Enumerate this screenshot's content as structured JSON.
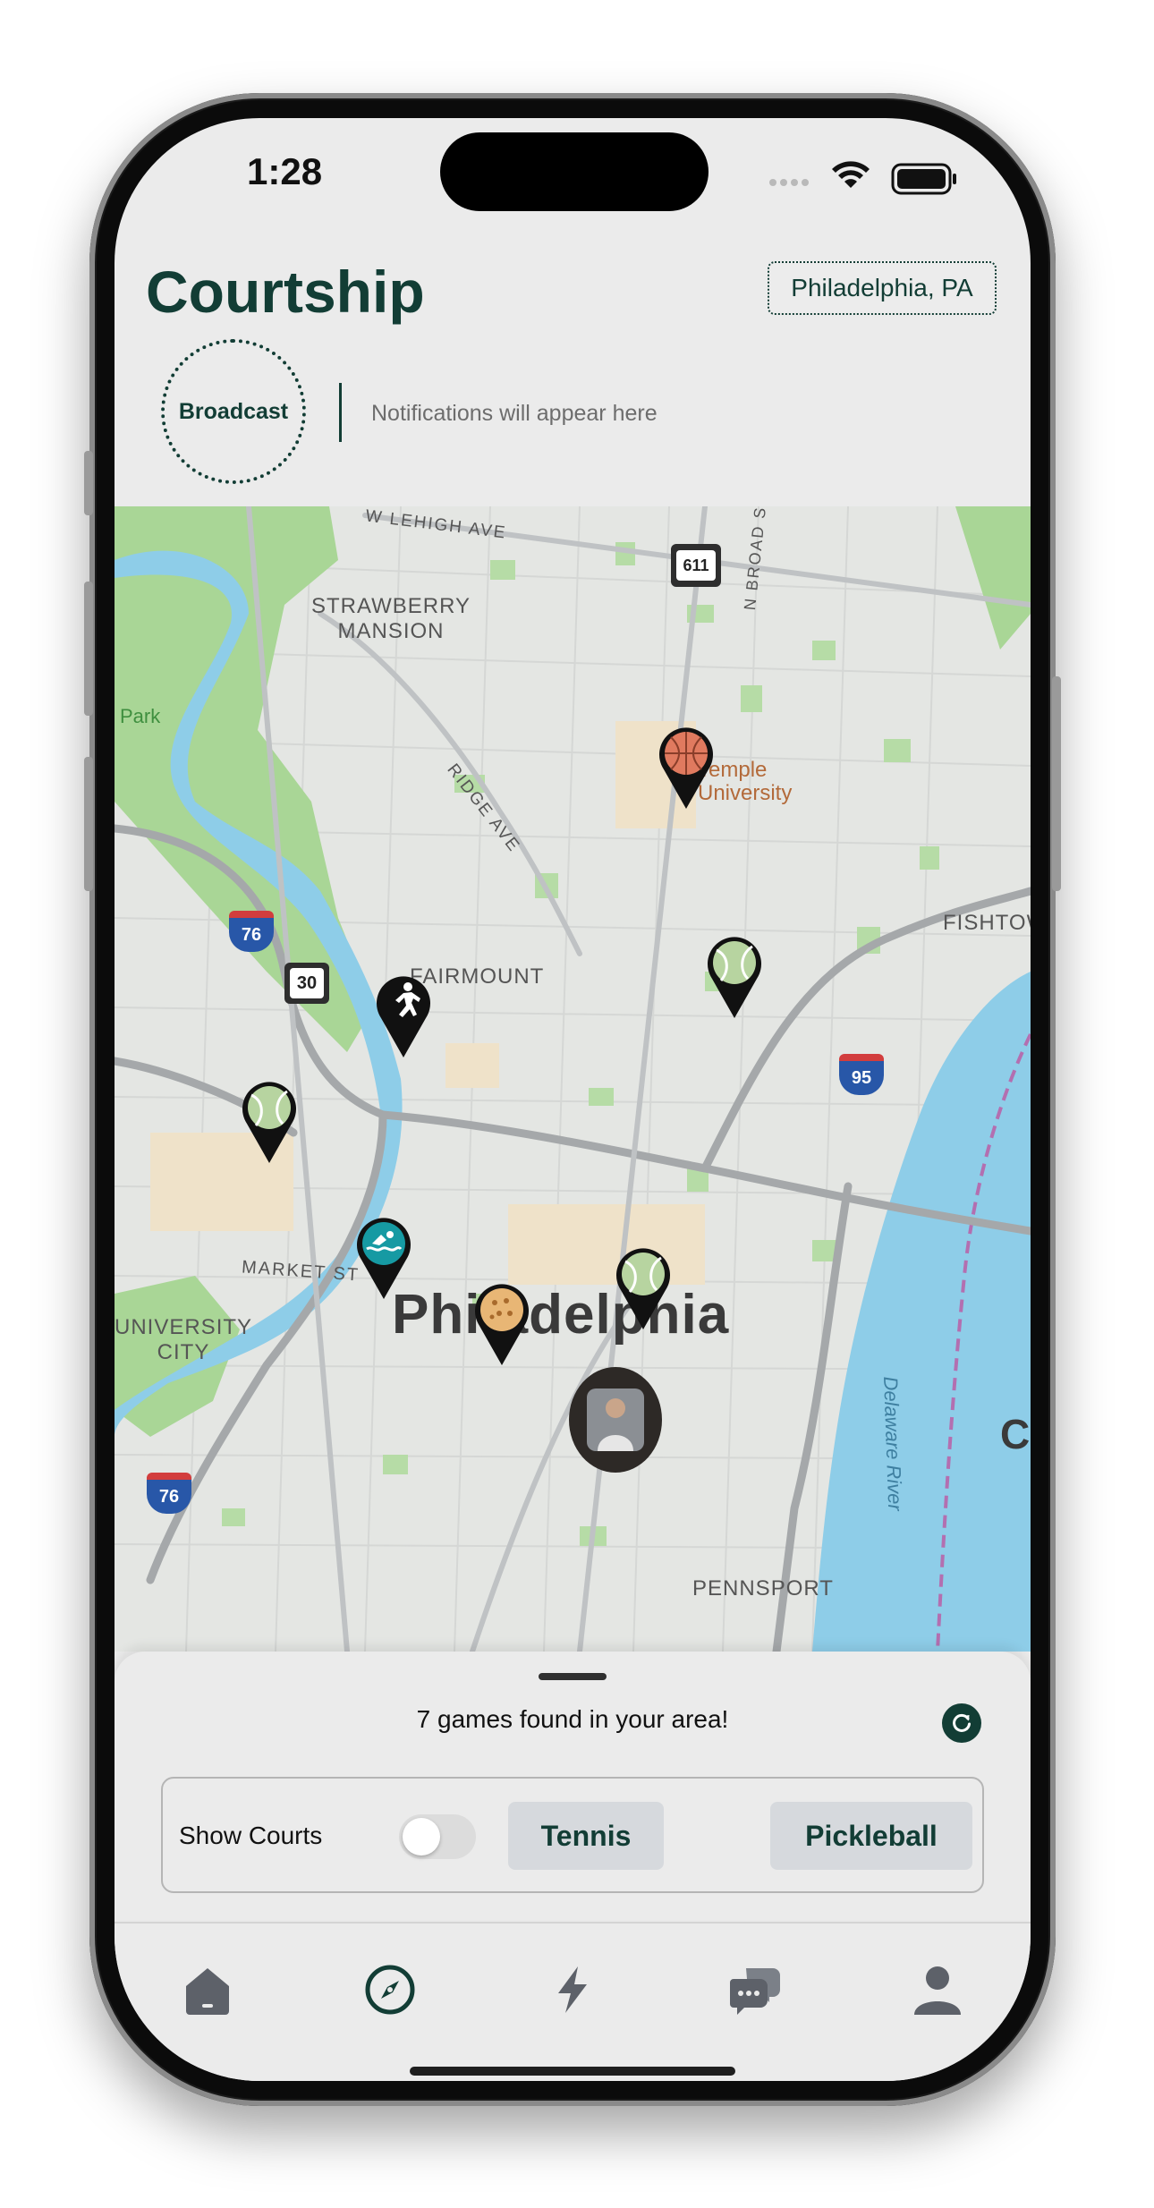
{
  "status_bar": {
    "time": "1:28"
  },
  "header": {
    "app_title": "Courtship",
    "location": "Philadelphia, PA"
  },
  "broadcast": {
    "label": "Broadcast",
    "notification_placeholder": "Notifications will appear here"
  },
  "map": {
    "city_label": "Philadelphia",
    "labels": {
      "lehigh": "W LEHIGH AVE",
      "strawberry_1": "STRAWBERRY",
      "strawberry_2": "MANSION",
      "park": "Park",
      "broad_st": "N BROAD ST",
      "temple_1": "Temple",
      "temple_2": "University",
      "ridge": "RIDGE AVE",
      "fishtown": "FISHTOW",
      "fairmount": "FAIRMOUNT",
      "market": "MARKET ST",
      "univ_city_1": "UNIVERSITY",
      "univ_city_2": "CITY",
      "pennsport": "PENNSPORT",
      "delaware": "Delaware River",
      "camden_partial": "Ca"
    },
    "shields": {
      "route_611": "611",
      "i76_north": "76",
      "us30": "30",
      "i95": "95",
      "i76_south": "76"
    },
    "pins": [
      {
        "sport": "basketball",
        "icon": "basketball-icon"
      },
      {
        "sport": "tennis",
        "icon": "tennis-ball-icon"
      },
      {
        "sport": "running",
        "icon": "runner-icon"
      },
      {
        "sport": "tennis",
        "icon": "tennis-ball-icon"
      },
      {
        "sport": "swimming",
        "icon": "swimmer-icon"
      },
      {
        "sport": "tennis",
        "icon": "tennis-ball-icon"
      },
      {
        "sport": "pickleball",
        "icon": "pickleball-icon"
      }
    ]
  },
  "sheet": {
    "games_found": "7 games found in your area!",
    "show_courts_label": "Show Courts",
    "show_courts_on": false,
    "filters": [
      "Tennis",
      "Pickleball"
    ]
  },
  "tab_bar": {
    "tabs": [
      {
        "icon": "home-icon",
        "active": false
      },
      {
        "icon": "compass-icon",
        "active": true
      },
      {
        "icon": "bolt-icon",
        "active": false
      },
      {
        "icon": "chat-bubbles-icon",
        "active": false
      },
      {
        "icon": "profile-icon",
        "active": false
      }
    ]
  },
  "colors": {
    "brand": "#123d35",
    "background": "#ebebeb",
    "water": "#87cbe6",
    "park": "#a3d48f"
  }
}
